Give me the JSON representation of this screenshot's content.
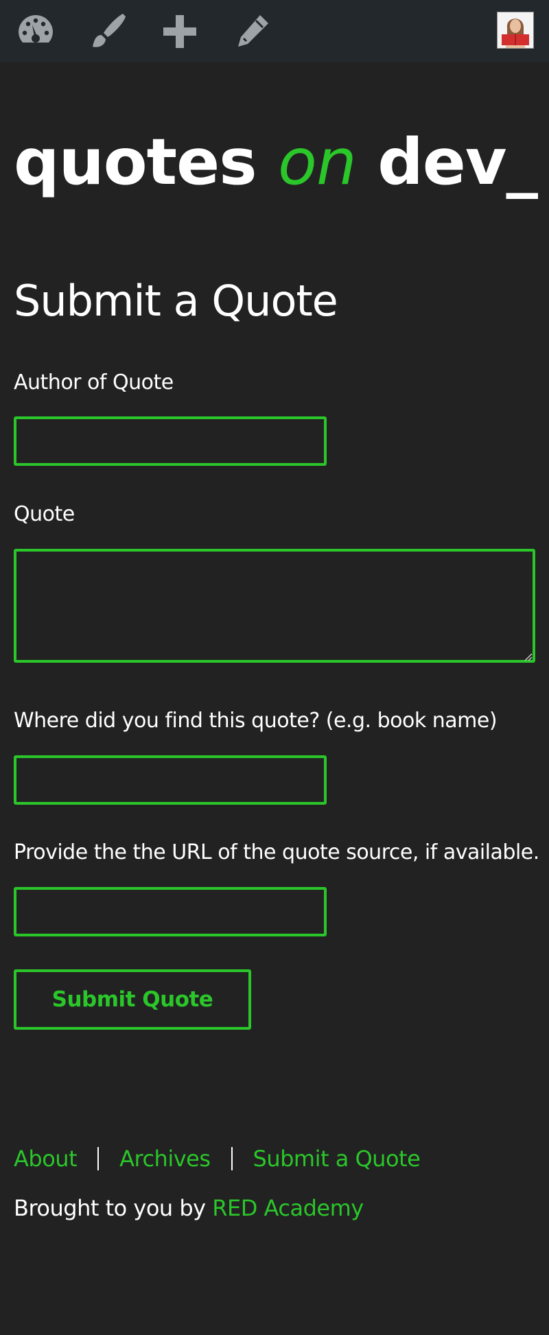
{
  "admin_bar": {
    "icons": [
      "dashboard-icon",
      "customize-brush-icon",
      "new-plus-icon",
      "edit-pencil-icon"
    ],
    "avatar": "user-avatar"
  },
  "site": {
    "title_part1": "quotes",
    "title_part2": "on",
    "title_part3": "dev_"
  },
  "page": {
    "title": "Submit a Quote"
  },
  "form": {
    "author_label": "Author of Quote",
    "author_value": "",
    "quote_label": "Quote",
    "quote_value": "",
    "source_label": "Where did you find this quote? (e.g. book name)",
    "source_value": "",
    "url_label": "Provide the the URL of the quote source, if available.",
    "url_value": "",
    "submit_label": "Submit Quote"
  },
  "footer": {
    "nav": [
      "About",
      "Archives",
      "Submit a Quote"
    ],
    "credit_prefix": "Brought to you by",
    "credit_link": "RED Academy"
  },
  "colors": {
    "accent": "#2ac62a",
    "background": "#222222",
    "admin_bar": "#23282d",
    "icon": "#9ea3a8"
  }
}
